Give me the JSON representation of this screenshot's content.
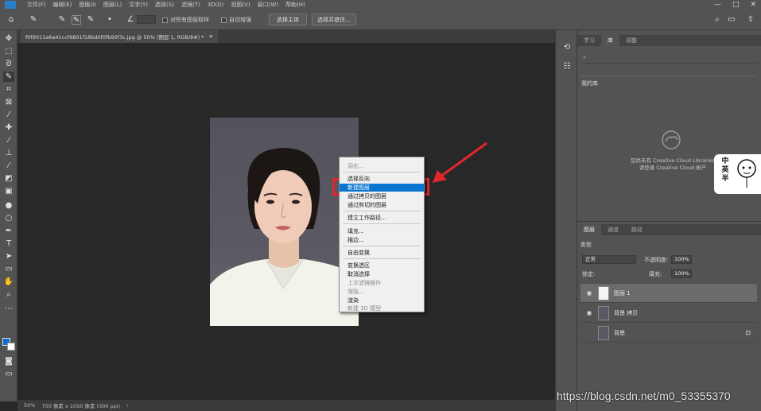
{
  "menubar": {
    "items": [
      "文件(F)",
      "编辑(E)",
      "图像(I)",
      "图层(L)",
      "文字(Y)",
      "选择(S)",
      "滤镜(T)",
      "3D(D)",
      "视图(V)",
      "窗口(W)",
      "帮助(H)"
    ],
    "window_controls": [
      "—",
      "□",
      "✕"
    ]
  },
  "optionsbar": {
    "checkbox_sample_all": "对所有图层取样",
    "checkbox_auto_enhance": "自动增强",
    "select_subject": "选择主体",
    "select_and_mask": "选择并遮住..."
  },
  "document": {
    "tab_title": "f0f9011a6a41ccf6801f18bd0f0fb90f3c.jpg @ 50% (图层 1, RGB/8#) *",
    "close": "✕"
  },
  "status": {
    "zoom": "50%",
    "doc_size": "750 像素 x 1050 像素 (300 ppi)",
    "arrow": "›"
  },
  "context_menu": {
    "items": [
      {
        "label": "羽化...",
        "state": "disabled"
      },
      {
        "label": "选择反向",
        "state": "normal"
      },
      {
        "label": "新建图层",
        "state": "selected"
      },
      {
        "label": "通过拷贝的图层",
        "state": "normal"
      },
      {
        "label": "通过剪切的图层",
        "state": "normal"
      },
      {
        "label": "建立工作路径...",
        "state": "normal"
      },
      {
        "label": "填充...",
        "state": "normal"
      },
      {
        "label": "描边...",
        "state": "normal"
      },
      {
        "label": "自由变换",
        "state": "normal"
      },
      {
        "label": "变换选区",
        "state": "normal"
      },
      {
        "label": "取消选择",
        "state": "normal"
      },
      {
        "label": "上次滤镜操作",
        "state": "disabled"
      },
      {
        "label": "渐隐...",
        "state": "disabled"
      },
      {
        "label": "渲染",
        "state": "normal"
      },
      {
        "label": "新建 3D 模型",
        "state": "disabled"
      }
    ]
  },
  "libraries_panel": {
    "tabs": [
      "学习",
      "库",
      "调整"
    ],
    "search_icon": "⌕",
    "select_label": "我的库",
    "empty_text_line1": "您尚未有 Creative Cloud Libraries",
    "empty_text_line2": "请登录 Creative Cloud 帐户"
  },
  "layers_panel": {
    "tabs": [
      "图层",
      "通道",
      "路径"
    ],
    "filter_kind": "类型",
    "blend_mode": "正常",
    "opacity_label": "不透明度:",
    "opacity_value": "100%",
    "lock_label": "锁定:",
    "fill_label": "填充:",
    "fill_value": "100%",
    "layers": [
      {
        "name": "图层 1",
        "visible": true,
        "active": true,
        "locked": false
      },
      {
        "name": "背景 拷贝",
        "visible": true,
        "active": false,
        "locked": false
      },
      {
        "name": "背景",
        "visible": false,
        "active": false,
        "locked": true
      }
    ]
  },
  "watermark": "https://blog.csdn.net/m0_53355370",
  "sticker": {
    "chars": [
      "中",
      "英",
      "半"
    ]
  },
  "colors": {
    "highlight": "#e2272b",
    "foreground": "#0a6ed1",
    "selected_menu": "#0a74d1"
  }
}
